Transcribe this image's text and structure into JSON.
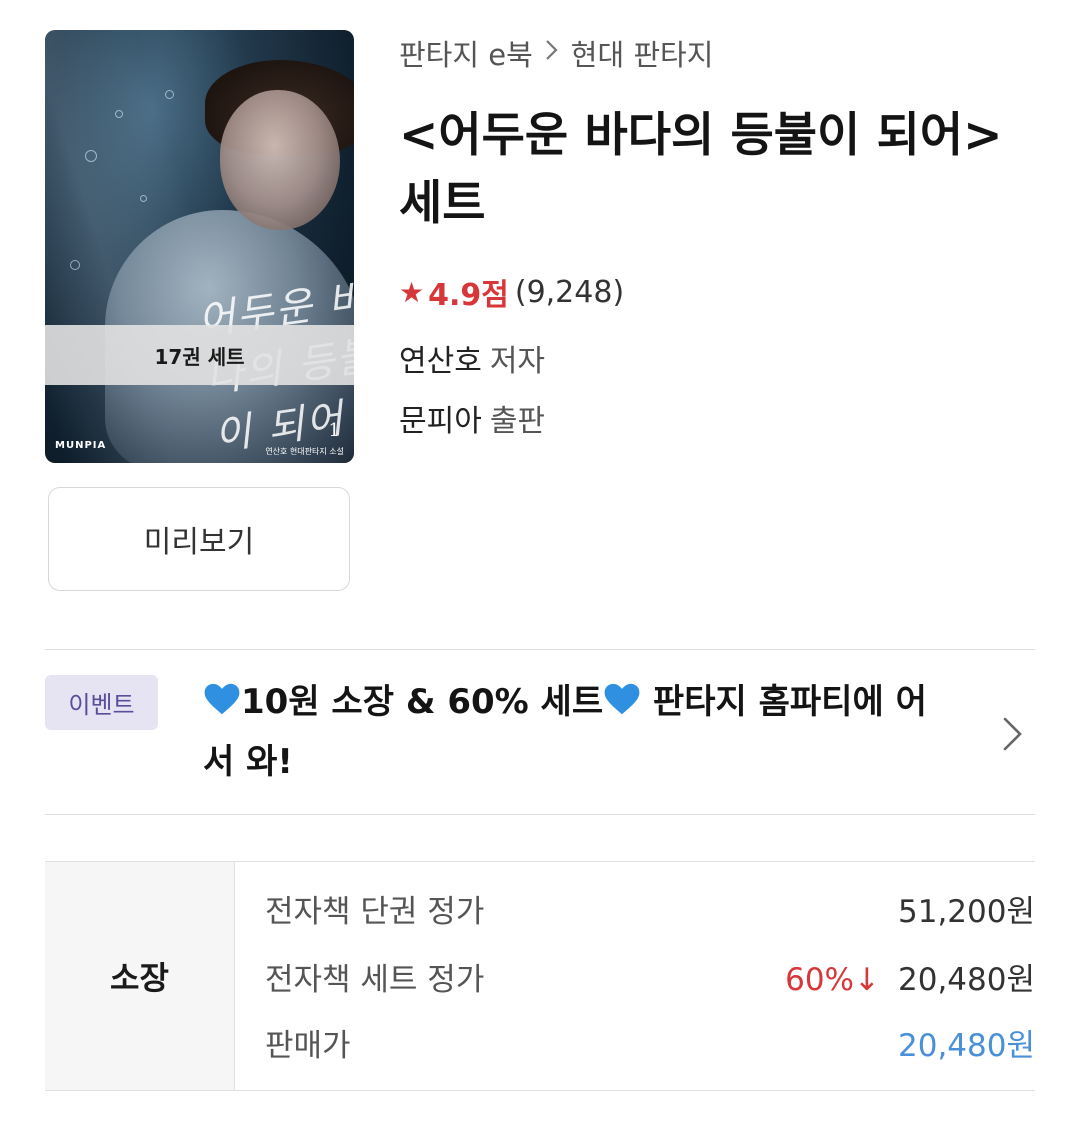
{
  "breadcrumb": {
    "category": "판타지 e북",
    "subcategory": "현대 판타지"
  },
  "book": {
    "title": "<어두운 바다의 등불이 되어> 세트",
    "rating_score": "4.9점",
    "rating_count": "(9,248)",
    "author": "연산호",
    "author_role": "저자",
    "publisher": "문피아",
    "publisher_role": "출판"
  },
  "cover": {
    "title_text": "어두운 바다의 등불이 되어",
    "set_badge": "17권 세트",
    "brand": "MUNPIA",
    "volume": "1",
    "author_line": "연산호 현대판타지 소설"
  },
  "preview_button": "미리보기",
  "event": {
    "badge": "이벤트",
    "text_line1": "10원 소장 & 60% 세트",
    "text_line1b": " 판타지 홈파티에 어",
    "text_line2": "서 와!",
    "heart_icon": "blue-heart-icon"
  },
  "price": {
    "section_label": "소장",
    "rows": [
      {
        "label": "전자책 단권 정가",
        "discount": "",
        "value": "51,200원"
      },
      {
        "label": "전자책 세트 정가",
        "discount": "60%↓",
        "value": "20,480원"
      },
      {
        "label": "판매가",
        "discount": "",
        "value": "20,480원"
      }
    ]
  },
  "colors": {
    "accent_red": "#d8373a",
    "sale_blue": "#4a90d9",
    "event_badge_bg": "#e6e3f3"
  }
}
